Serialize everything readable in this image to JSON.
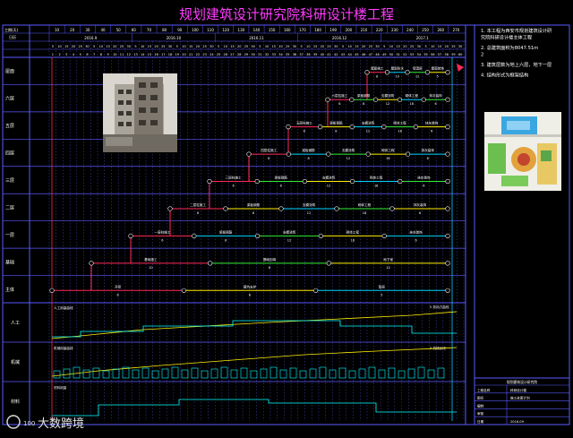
{
  "title": "规划建筑设计研究院科研设计楼工程",
  "colors": {
    "background": "#000000",
    "title": "#ff3cff",
    "frame": "#5a5aff",
    "grid": "#5a5aff",
    "critical": "#ff2a55",
    "normal": "#ffee00",
    "alt": "#00d4ff",
    "green": "#33ee33",
    "white": "#ffffff",
    "curve": "#00ffff"
  },
  "timeline": {
    "row1_label": "工期(天)",
    "row2_label": "日历",
    "months": [
      "2016.9",
      "2016.10",
      "2016.11",
      "2016.12",
      "2017.1"
    ],
    "tick_numbers": [
      "10",
      "20",
      "30",
      "40",
      "50",
      "60",
      "70",
      "80",
      "90",
      "100",
      "110",
      "120",
      "130",
      "140",
      "150",
      "160",
      "170",
      "180",
      "190",
      "200",
      "210",
      "220",
      "230",
      "240",
      "250",
      "260",
      "270"
    ],
    "days": [
      "5",
      "10",
      "15",
      "20",
      "25",
      "30",
      "5",
      "10",
      "15",
      "20",
      "25",
      "30",
      "5",
      "10",
      "15",
      "20",
      "25",
      "30",
      "5",
      "10",
      "15",
      "20",
      "25",
      "30",
      "5",
      "10",
      "15",
      "20",
      "25",
      "30",
      "5",
      "10",
      "15",
      "20",
      "25",
      "30",
      "5",
      "10",
      "15",
      "20",
      "25",
      "30",
      "5",
      "10",
      "15",
      "20",
      "25",
      "30",
      "5",
      "10",
      "15",
      "20",
      "25",
      "30",
      "5",
      "10",
      "15",
      "20",
      "25",
      "30"
    ]
  },
  "rows": [
    "屋面",
    "六层",
    "五层",
    "四层",
    "三层",
    "二层",
    "一层",
    "基础",
    "主体"
  ],
  "resource_rows": [
    "人工",
    "机械",
    "材料"
  ],
  "chart_labels": {
    "labor_title": "人工用量曲线",
    "labor_right": "5 劳动力曲线",
    "machine_title": "机械用量曲线",
    "machine_right": "5 机械台班",
    "material_title": "材料用量"
  },
  "notes": [
    "1. 本工程为西安市规划建筑设计研究院科研设计楼主体工程",
    "2. 总建筑面积为8047.51m2",
    "3. 建筑层数为地上六层，地下一层",
    "4. 结构形式为框架结构"
  ],
  "title_block": {
    "caption": "规划建筑设计研究院",
    "rows": [
      [
        "工程名称",
        "科研设计楼"
      ],
      [
        "图名",
        "施工进度计划"
      ],
      [
        "编制",
        ""
      ],
      [
        "审核",
        ""
      ],
      [
        "日期",
        "2016.09"
      ]
    ]
  },
  "watermark": "大数跨境",
  "tasks": [
    {
      "row": 0,
      "labels": [
        "屋面施工",
        "屋面防水",
        "保温层",
        "屋面装饰"
      ],
      "durations": [
        "8",
        "10",
        "12",
        "5"
      ]
    },
    {
      "row": 1,
      "labels": [
        "六层柱施工",
        "梁板钢筋",
        "支模浇筑",
        "砌体工程",
        "抹灰装饰"
      ],
      "durations": [
        "6",
        "8",
        "12",
        "18",
        "6"
      ]
    },
    {
      "row": 2,
      "labels": [
        "五层柱施工",
        "梁板钢筋",
        "支模浇筑",
        "砌体工程",
        "抹灰装饰"
      ],
      "durations": [
        "6",
        "8",
        "12",
        "18",
        "6"
      ]
    },
    {
      "row": 3,
      "labels": [
        "四层柱施工",
        "梁板钢筋",
        "支模浇筑",
        "砌体工程",
        "抹灰装饰"
      ],
      "durations": [
        "6",
        "8",
        "12",
        "18",
        "6"
      ]
    },
    {
      "row": 4,
      "labels": [
        "三层柱施工",
        "梁板钢筋",
        "支模浇筑",
        "砌体工程",
        "抹灰装饰"
      ],
      "durations": [
        "6",
        "8",
        "12",
        "18",
        "6"
      ]
    },
    {
      "row": 5,
      "labels": [
        "二层柱施工",
        "梁板钢筋",
        "支模浇筑",
        "砌体工程",
        "抹灰装饰"
      ],
      "durations": [
        "6",
        "8",
        "12",
        "18",
        "6"
      ]
    },
    {
      "row": 6,
      "labels": [
        "一层柱施工",
        "梁板钢筋",
        "支模浇筑",
        "砌体工程",
        "抹灰装饰"
      ],
      "durations": [
        "6",
        "8",
        "12",
        "18",
        "6"
      ]
    },
    {
      "row": 7,
      "labels": [
        "基础施工",
        "基础回填",
        "地下室"
      ],
      "durations": [
        "10",
        "8",
        "12"
      ]
    },
    {
      "row": 8,
      "labels": [
        "开挖",
        "基坑支护",
        "垫层"
      ],
      "durations": [
        "6",
        "8",
        "5"
      ]
    }
  ],
  "photos": {
    "building": "building-photo",
    "site_plan": "site-plan"
  }
}
